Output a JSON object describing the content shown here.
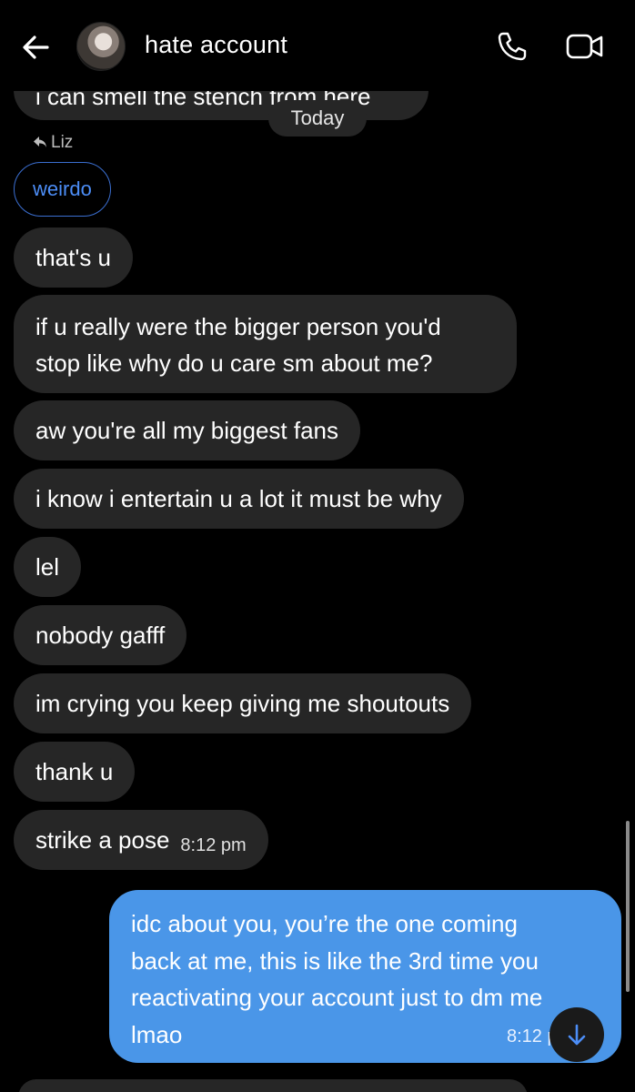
{
  "header": {
    "title": "hate account",
    "back_icon": "arrow-left-icon",
    "call_icon": "phone-icon",
    "video_icon": "video-camera-icon"
  },
  "divider": {
    "label": "Today"
  },
  "reply": {
    "to_name": "Liz",
    "quoted_text": "weirdo"
  },
  "messages_received": [
    {
      "text": "i can smell the stench from here"
    },
    {
      "text": "that's u"
    },
    {
      "lines": [
        "if u really were the bigger person you'd",
        "stop like why do u care sm about me?"
      ]
    },
    {
      "text": "aw you're all my biggest fans"
    },
    {
      "text": "i know i entertain u a lot it must be why"
    },
    {
      "text": "lel"
    },
    {
      "text": "nobody gafff"
    },
    {
      "text": "im crying you keep giving me shoutouts"
    },
    {
      "text": "thank u"
    },
    {
      "text": "strike a pose",
      "time": "8:12 pm"
    }
  ],
  "message_sent": {
    "lines": [
      "idc about you, you’re the one coming",
      "back at me, this is like the 3rd time you",
      "reactivating your account just to dm me",
      "lmao"
    ],
    "time": "8:12 pm",
    "color": "#4a96e8"
  },
  "colors": {
    "bubble_received": "#262626",
    "reply_accent": "#4c8df6",
    "background": "#000000"
  }
}
